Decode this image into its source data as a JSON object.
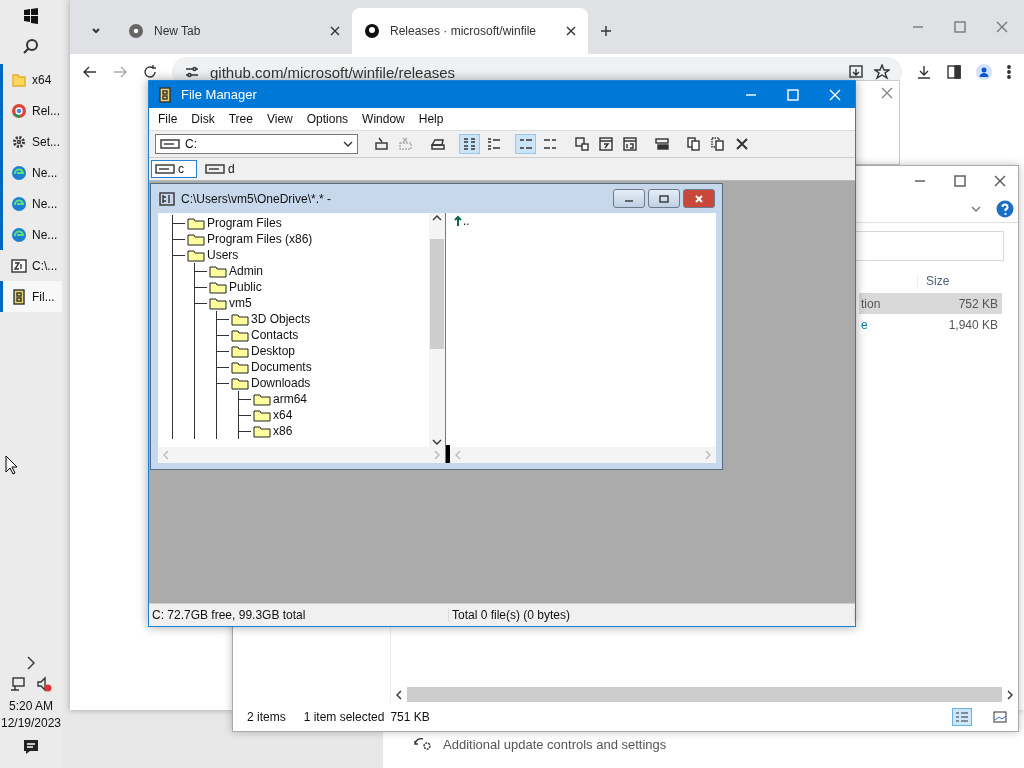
{
  "taskbar": {
    "items": [
      {
        "kind": "folder",
        "label": "x64",
        "running": true,
        "selected": false
      },
      {
        "kind": "chrome",
        "label": "Rel...",
        "running": true,
        "selected": false
      },
      {
        "kind": "gear",
        "label": "Set...",
        "running": true,
        "selected": false
      },
      {
        "kind": "edge",
        "label": "Ne...",
        "running": true,
        "selected": false
      },
      {
        "kind": "edge",
        "label": "Ne...",
        "running": true,
        "selected": false
      },
      {
        "kind": "edge",
        "label": "Ne...",
        "running": true,
        "selected": false
      },
      {
        "kind": "archive",
        "label": "C:\\...",
        "running": false,
        "selected": false
      },
      {
        "kind": "filemanager",
        "label": "Fil...",
        "running": true,
        "selected": true
      }
    ],
    "time": "5:20 AM",
    "date": "12/19/2023"
  },
  "settings": {
    "subtitle": "Additional update controls and settings"
  },
  "browser": {
    "tabs": [
      {
        "kind": "chrome",
        "title": "New Tab",
        "selected": false
      },
      {
        "kind": "github",
        "title": "Releases · microsoft/winfile",
        "selected": true
      }
    ],
    "url": "github.com/microsoft/winfile/releases"
  },
  "explorer": {
    "columns": [
      "Size"
    ],
    "rows": [
      {
        "name": "tion",
        "size": "752 KB",
        "selected": true,
        "link": false
      },
      {
        "name": "e",
        "size": "1,940 KB",
        "selected": false,
        "link": true
      }
    ],
    "status": {
      "count": "2 items",
      "selection": "1 item selected",
      "size": "751 KB"
    },
    "views": [
      {
        "kind": "details",
        "selected": true
      },
      {
        "kind": "preview",
        "selected": false
      }
    ]
  },
  "file_manager": {
    "title": "File Manager",
    "menu": [
      "File",
      "Disk",
      "Tree",
      "View",
      "Options",
      "Window",
      "Help"
    ],
    "drive_combo": "C:",
    "toolbar": [
      {
        "kind": "connect",
        "pressed": false,
        "disabled": false
      },
      {
        "kind": "disconnect",
        "pressed": false,
        "disabled": true
      },
      {
        "kind": "share",
        "pressed": false,
        "disabled": false
      },
      {
        "kind": "icons",
        "pressed": true,
        "disabled": false
      },
      {
        "kind": "list",
        "pressed": false,
        "disabled": false
      },
      {
        "kind": "sort-az",
        "pressed": true,
        "disabled": false
      },
      {
        "kind": "sort-type",
        "pressed": false,
        "disabled": false
      },
      {
        "kind": "window",
        "pressed": false,
        "disabled": false
      },
      {
        "kind": "calendar",
        "pressed": false,
        "disabled": false
      },
      {
        "kind": "number",
        "pressed": false,
        "disabled": false
      },
      {
        "kind": "split",
        "pressed": false,
        "disabled": false
      },
      {
        "kind": "copy",
        "pressed": false,
        "disabled": false
      },
      {
        "kind": "paste",
        "pressed": false,
        "disabled": false
      },
      {
        "kind": "delete",
        "pressed": false,
        "disabled": false
      }
    ],
    "drives": [
      {
        "label": "c",
        "selected": true
      },
      {
        "label": "d",
        "selected": false
      }
    ],
    "child": {
      "title": "C:\\Users\\vm5\\OneDrive\\*.* -",
      "tree": [
        {
          "label": "Program Files"
        },
        {
          "label": "Program Files (x86)"
        },
        {
          "label": "Users",
          "children": [
            {
              "label": "Admin"
            },
            {
              "label": "Public"
            },
            {
              "label": "vm5",
              "children": [
                {
                  "label": "3D Objects"
                },
                {
                  "label": "Contacts"
                },
                {
                  "label": "Desktop"
                },
                {
                  "label": "Documents"
                },
                {
                  "label": "Downloads",
                  "children": [
                    {
                      "label": "arm64"
                    },
                    {
                      "label": "x64"
                    },
                    {
                      "label": "x86"
                    }
                  ]
                }
              ]
            }
          ]
        }
      ],
      "files": [
        ".."
      ]
    },
    "status": {
      "disk": "C: 72.7GB free,  99.3GB total",
      "files": "Total 0 file(s) (0 bytes)"
    }
  }
}
